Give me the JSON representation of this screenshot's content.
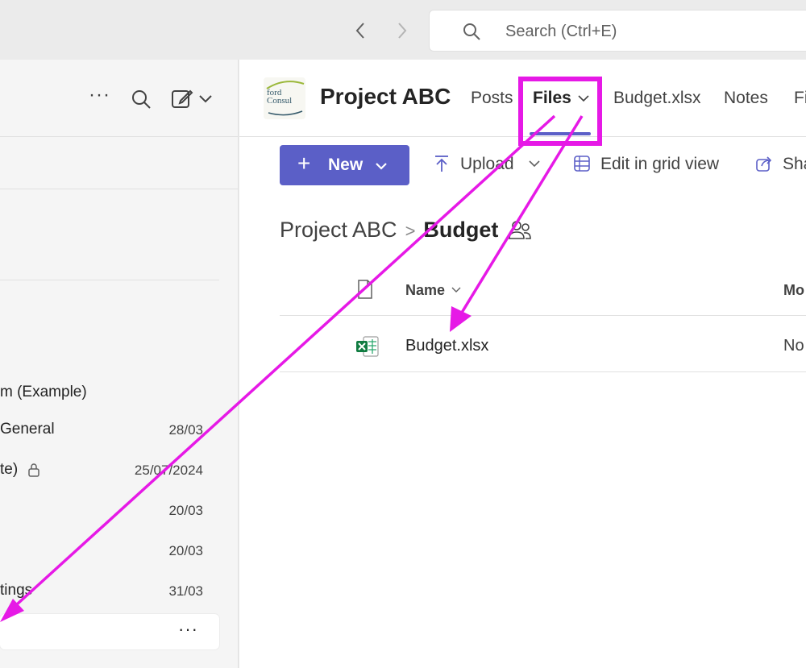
{
  "topbar": {
    "back_icon": "chevron-left-icon",
    "forward_icon": "chevron-right-icon",
    "search_placeholder": "Search (Ctrl+E)"
  },
  "left_panel": {
    "more_label": "···",
    "items": [
      {
        "label": "m (Example)",
        "date": ""
      },
      {
        "label": "General",
        "date": "28/03"
      },
      {
        "label": "te)",
        "date": "25/07/2024",
        "locked": true
      },
      {
        "label": "",
        "date": "20/03"
      },
      {
        "label": "",
        "date": "20/03"
      },
      {
        "label": "tings",
        "date": "31/03"
      },
      {
        "label": "",
        "date": "",
        "more": "···",
        "selected": true
      }
    ]
  },
  "main": {
    "team": {
      "logo_text": "ford Consul",
      "name": "Project ABC"
    },
    "tabs": {
      "posts": "Posts",
      "files": "Files",
      "budget": "Budget.xlsx",
      "notes": "Notes",
      "more": "Fi"
    },
    "toolbar": {
      "new_label": "New",
      "upload_label": "Upload",
      "grid_label": "Edit in grid view",
      "share_label": "Sha"
    },
    "breadcrumb": {
      "root": "Project ABC",
      "current": "Budget"
    },
    "table": {
      "col_name": "Name",
      "col_modified": "Mo",
      "rows": [
        {
          "name": "Budget.xlsx",
          "modified": "No"
        }
      ]
    }
  },
  "colors": {
    "accent": "#5b5fc7",
    "annotation": "#e619e6",
    "excel_green": "#107c41"
  }
}
